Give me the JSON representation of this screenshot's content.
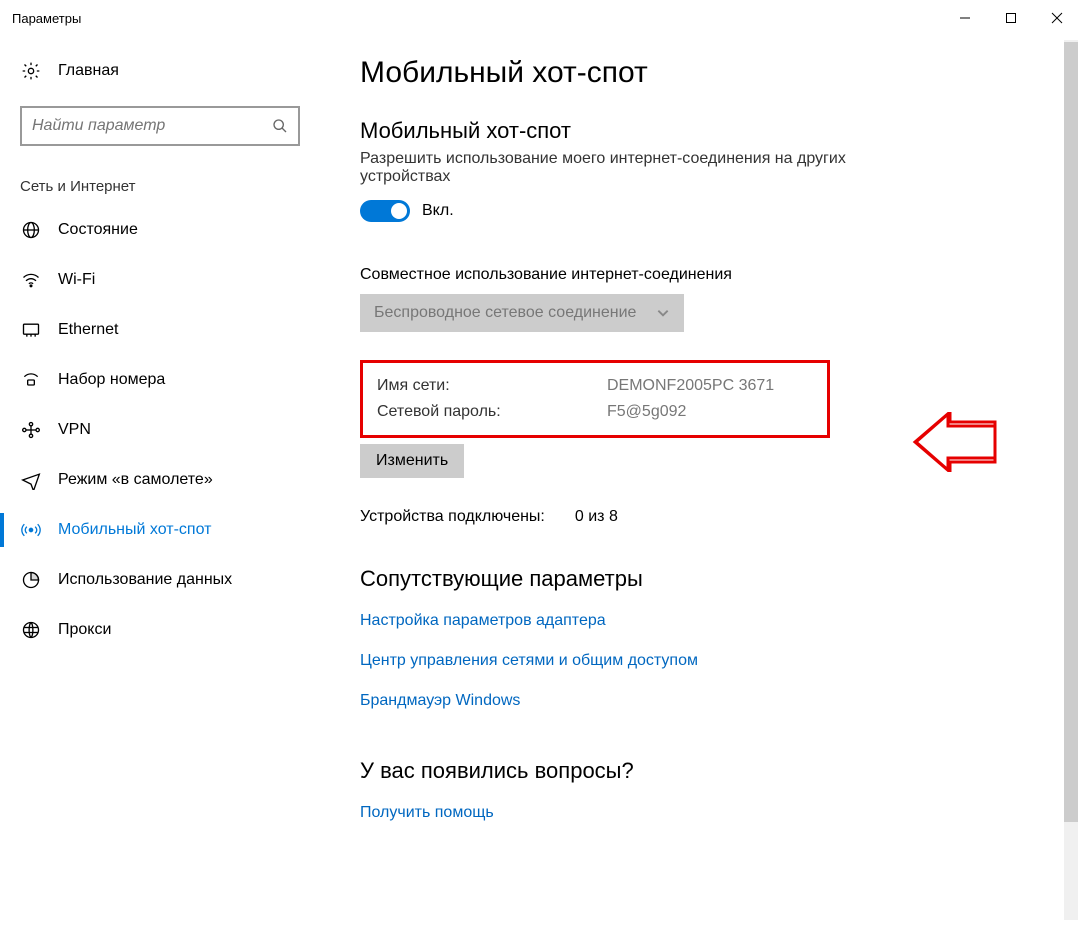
{
  "window": {
    "title": "Параметры"
  },
  "sidebar": {
    "home_label": "Главная",
    "search_placeholder": "Найти параметр",
    "category": "Сеть и Интернет",
    "items": [
      {
        "label": "Состояние"
      },
      {
        "label": "Wi-Fi"
      },
      {
        "label": "Ethernet"
      },
      {
        "label": "Набор номера"
      },
      {
        "label": "VPN"
      },
      {
        "label": "Режим «в самолете»"
      },
      {
        "label": "Мобильный хот-спот"
      },
      {
        "label": "Использование данных"
      },
      {
        "label": "Прокси"
      }
    ]
  },
  "main": {
    "title": "Мобильный хот-спот",
    "hotspot": {
      "heading": "Мобильный хот-спот",
      "description": "Разрешить использование моего интернет-соединения на других устройствах",
      "toggle_state": "Вкл."
    },
    "share": {
      "label": "Совместное использование интернет-соединения",
      "dropdown_value": "Беспроводное сетевое соединение"
    },
    "network": {
      "name_label": "Имя сети:",
      "name_value": "DEMONF2005PC 3671",
      "password_label": "Сетевой пароль:",
      "password_value": "F5@5g092",
      "change_button": "Изменить"
    },
    "devices": {
      "label": "Устройства подключены:",
      "value": "0 из 8"
    },
    "related": {
      "heading": "Сопутствующие параметры",
      "links": [
        "Настройка параметров адаптера",
        "Центр управления сетями и общим доступом",
        "Брандмауэр Windows"
      ]
    },
    "questions": {
      "heading": "У вас появились вопросы?",
      "link": "Получить помощь"
    }
  }
}
